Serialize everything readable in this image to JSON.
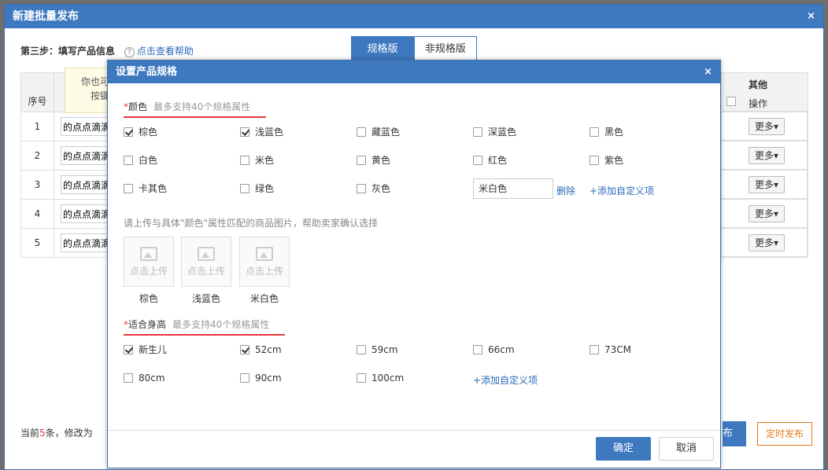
{
  "outer": {
    "title": "新建批量发布",
    "close": "×",
    "step_label": "第三步：填写产品信息",
    "help_link": "点击查看帮助",
    "tabs": [
      "规格版",
      "非规格版"
    ],
    "table": {
      "header_no": "序号",
      "header_other": "其他",
      "header_op": "操作",
      "rows": [
        {
          "no": "1",
          "name": "的点点滴滴",
          "more": "更多▾"
        },
        {
          "no": "2",
          "name": "的点点滴滴",
          "more": "更多▾"
        },
        {
          "no": "3",
          "name": "的点点滴滴",
          "more": "更多▾"
        },
        {
          "no": "4",
          "name": "的点点滴滴",
          "more": "更多▾"
        },
        {
          "no": "5",
          "name": "的点点滴滴",
          "more": "更多▾"
        }
      ]
    },
    "tip": [
      "你也可",
      "按键"
    ],
    "footer_prefix": "当前",
    "footer_count": "5",
    "footer_suffix": "条，修改为",
    "publish_btn": "布",
    "timed_btn": "定时发布"
  },
  "modal": {
    "title": "设置产品规格",
    "close": "×",
    "color_section": {
      "star": "*",
      "label": "颜色",
      "hint": "最多支持40个规格属性",
      "options": [
        {
          "label": "棕色",
          "checked": true
        },
        {
          "label": "浅蓝色",
          "checked": true
        },
        {
          "label": "藏蓝色",
          "checked": false
        },
        {
          "label": "深蓝色",
          "checked": false
        },
        {
          "label": "黑色",
          "checked": false
        },
        {
          "label": "白色",
          "checked": false
        },
        {
          "label": "米色",
          "checked": false
        },
        {
          "label": "黄色",
          "checked": false
        },
        {
          "label": "红色",
          "checked": false
        },
        {
          "label": "紫色",
          "checked": false
        },
        {
          "label": "卡其色",
          "checked": false
        },
        {
          "label": "绿色",
          "checked": false
        },
        {
          "label": "灰色",
          "checked": false
        }
      ],
      "custom_value": "米白色",
      "delete_link": "删除",
      "add_link": "+添加自定义项"
    },
    "upload": {
      "note": "请上传与具体\"颜色\"属性匹配的商品图片，帮助卖家确认选择",
      "box_text": "点击上传",
      "captions": [
        "棕色",
        "浅蓝色",
        "米白色"
      ]
    },
    "height_section": {
      "star": "*",
      "label": "适合身高",
      "hint": "最多支持40个规格属性",
      "options": [
        {
          "label": "新生儿",
          "checked": true
        },
        {
          "label": "52cm",
          "checked": true
        },
        {
          "label": "59cm",
          "checked": false
        },
        {
          "label": "66cm",
          "checked": false
        },
        {
          "label": "73CM",
          "checked": false
        },
        {
          "label": "80cm",
          "checked": false
        },
        {
          "label": "90cm",
          "checked": false
        },
        {
          "label": "100cm",
          "checked": false
        }
      ],
      "add_link": "+添加自定义项"
    },
    "ok_btn": "确定",
    "cancel_btn": "取消"
  }
}
